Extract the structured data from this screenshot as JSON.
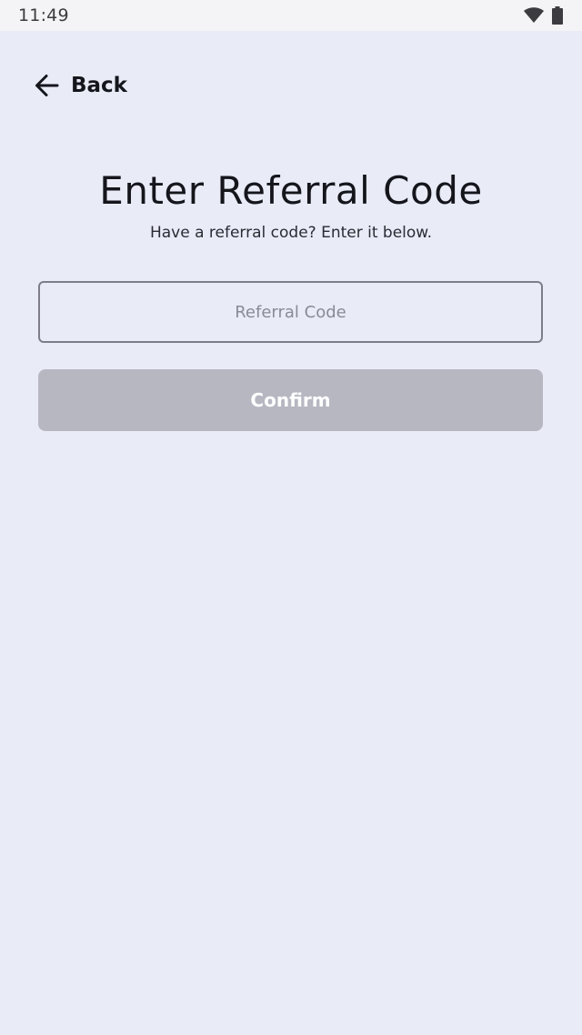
{
  "status_bar": {
    "time": "11:49",
    "icons": [
      "wifi-icon",
      "battery-icon"
    ]
  },
  "header": {
    "back_label": "Back",
    "back_icon": "arrow-left-icon"
  },
  "main": {
    "title": "Enter Referral Code",
    "subtitle": "Have a referral code? Enter it below.",
    "referral_input": {
      "value": "",
      "placeholder": "Referral Code"
    },
    "confirm_label": "Confirm"
  },
  "colors": {
    "background": "#e9ebf7",
    "status_bar": "#f4f4f6",
    "text": "#15161c",
    "input_border": "#7d7e88",
    "placeholder": "#8a8b94",
    "button_disabled": "#b6b7c1",
    "button_text": "#ffffff"
  }
}
